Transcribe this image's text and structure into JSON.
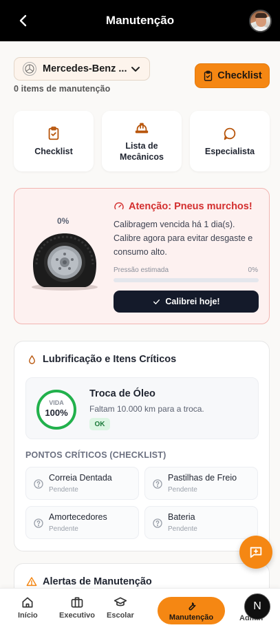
{
  "header": {
    "title": "Manutenção"
  },
  "vehicle": {
    "name": "Mercedes-Benz ...",
    "items_count": "0 items de manutenção"
  },
  "checklist_button": {
    "label": "Checklist"
  },
  "quick_actions": [
    {
      "label": "Checklist",
      "icon": "clipboard-check-icon"
    },
    {
      "label": "Lista de Mecânicos",
      "icon": "hard-hat-icon"
    },
    {
      "label": "Especialista",
      "icon": "chat-bubble-icon"
    }
  ],
  "tire_alert": {
    "percent": "0%",
    "title": "Atenção: Pneus murchos!",
    "text": "Calibragem vencida há 1 dia(s). Calibre agora para evitar desgaste e consumo alto.",
    "pressure_label": "Pressão estimada",
    "pressure_value": "0%",
    "pressure_fraction": 0,
    "button": "Calibrei hoje!"
  },
  "lubrication": {
    "title": "Lubrificação e Itens Críticos",
    "oil": {
      "life_label": "VIDA",
      "life_value": "100%",
      "life_fraction": 1,
      "name": "Troca de Óleo",
      "subtitle": "Faltam 10.000 km para a troca.",
      "status": "OK"
    },
    "critical_title": "PONTOS CRÍTICOS (CHECKLIST)",
    "critical_items": [
      {
        "name": "Correia Dentada",
        "status": "Pendente"
      },
      {
        "name": "Pastilhas de Freio",
        "status": "Pendente"
      },
      {
        "name": "Amortecedores",
        "status": "Pendente"
      },
      {
        "name": "Bateria",
        "status": "Pendente"
      }
    ]
  },
  "alerts_section": {
    "title": "Alertas de Manutenção"
  },
  "bottom_nav": {
    "items": [
      {
        "label": "Início",
        "icon": "home-icon"
      },
      {
        "label": "Executivo",
        "icon": "briefcase-icon"
      },
      {
        "label": "Escolar",
        "icon": "graduation-cap-icon"
      },
      {
        "label": "Manutenção",
        "icon": "wrench-icon",
        "active": true
      },
      {
        "label": "Admin",
        "icon": "admin-icon"
      }
    ],
    "user_initial": "N"
  },
  "colors": {
    "accent": "#f58713",
    "danger": "#d32f2f",
    "success": "#22b14c",
    "dark": "#141a2a"
  }
}
